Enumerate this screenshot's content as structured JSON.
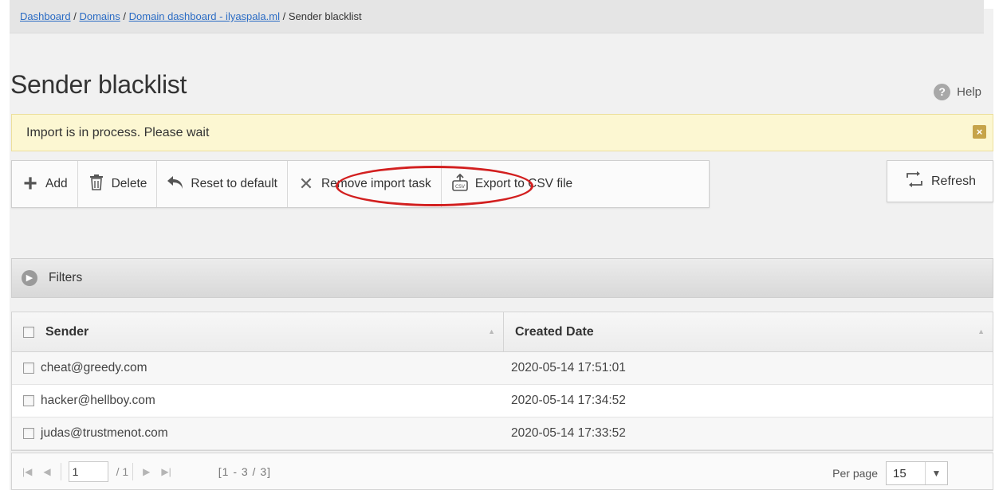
{
  "breadcrumb": {
    "items": [
      "Dashboard",
      "Domains",
      "Domain dashboard - ilyaspala.ml"
    ],
    "separator": "/",
    "current": "Sender blacklist"
  },
  "page": {
    "title": "Sender blacklist",
    "help_label": "Help",
    "help_icon": "?"
  },
  "notice": {
    "text": "Import is in process. Please wait",
    "close_glyph": "×"
  },
  "toolbar": {
    "add_label": "Add",
    "delete_label": "Delete",
    "reset_label": "Reset to default",
    "remove_import_label": "Remove import task",
    "export_label": "Export to CSV file",
    "refresh_label": "Refresh"
  },
  "filters": {
    "label": "Filters"
  },
  "table": {
    "columns": [
      "Sender",
      "Created Date"
    ],
    "rows": [
      {
        "sender": "cheat@greedy.com",
        "created": "2020-05-14 17:51:01"
      },
      {
        "sender": "hacker@hellboy.com",
        "created": "2020-05-14 17:34:52"
      },
      {
        "sender": "judas@trustmenot.com",
        "created": "2020-05-14 17:33:52"
      }
    ]
  },
  "pager": {
    "page": "1",
    "of": "/ 1",
    "range": "[1 - 3 / 3]",
    "per_page_label": "Per page",
    "per_page_value": "15"
  },
  "colors": {
    "link": "#2b6cc4",
    "notice_bg": "#fcf7d2",
    "annotation": "#d21f1f"
  }
}
